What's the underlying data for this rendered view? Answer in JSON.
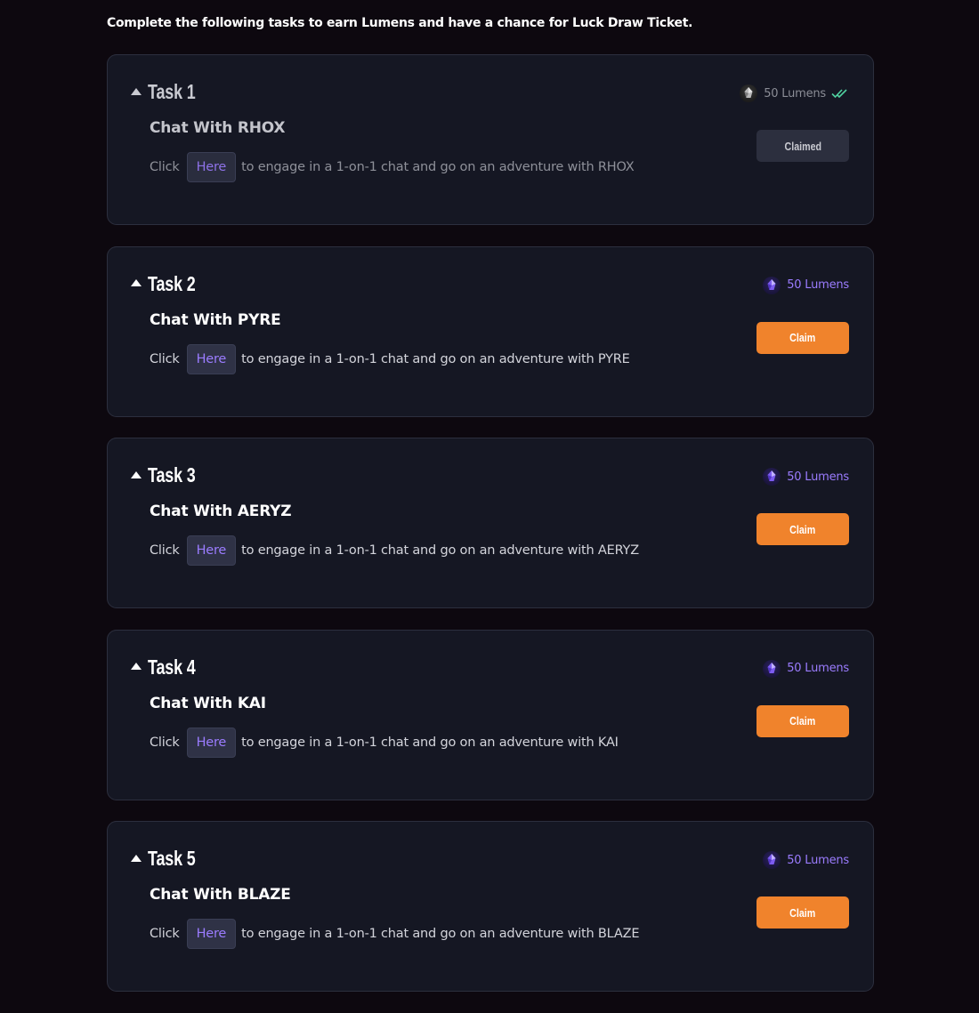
{
  "intro_text": "Complete the following tasks to earn Lumens and have a chance for Luck Draw Ticket.",
  "colors": {
    "page_background": "#0d080f",
    "card_background": "#151723",
    "accent_orange": "#f0832c",
    "lumen_purple": "#9b7cff",
    "claimed_check": "#4fd1a0"
  },
  "tasks": [
    {
      "title": "Task 1",
      "name": "Chat With RHOX",
      "desc_prefix": "Click",
      "link_label": "Here",
      "desc_suffix": "to engage in a 1-on-1 chat and go on an adventure with RHOX",
      "reward": "50 Lumens",
      "button_label": "Claimed",
      "claimed": true,
      "reward_icon": "lumen-crystal-icon",
      "status_icon": "double-check-icon"
    },
    {
      "title": "Task 2",
      "name": "Chat With PYRE",
      "desc_prefix": "Click",
      "link_label": "Here",
      "desc_suffix": "to engage in a 1-on-1 chat and go on an adventure with PYRE",
      "reward": "50 Lumens",
      "button_label": "Claim",
      "claimed": false,
      "reward_icon": "lumen-crystal-icon"
    },
    {
      "title": "Task 3",
      "name": "Chat With AERYZ",
      "desc_prefix": "Click",
      "link_label": "Here",
      "desc_suffix": "to engage in a 1-on-1 chat and go on an adventure with AERYZ",
      "reward": "50 Lumens",
      "button_label": "Claim",
      "claimed": false,
      "reward_icon": "lumen-crystal-icon"
    },
    {
      "title": "Task 4",
      "name": "Chat With KAI",
      "desc_prefix": "Click",
      "link_label": "Here",
      "desc_suffix": "to engage in a 1-on-1 chat and go on an adventure with KAI",
      "reward": "50 Lumens",
      "button_label": "Claim",
      "claimed": false,
      "reward_icon": "lumen-crystal-icon"
    },
    {
      "title": "Task 5",
      "name": "Chat With BLAZE",
      "desc_prefix": "Click",
      "link_label": "Here",
      "desc_suffix": "to engage in a 1-on-1 chat and go on an adventure with BLAZE",
      "reward": "50 Lumens",
      "button_label": "Claim",
      "claimed": false,
      "reward_icon": "lumen-crystal-icon"
    }
  ]
}
